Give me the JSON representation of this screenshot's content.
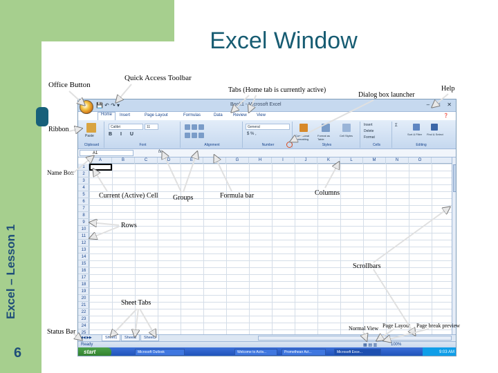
{
  "slide": {
    "title": "Excel Window",
    "side_label": "Excel – Lesson 1",
    "page_number": "6"
  },
  "annotations": {
    "office_button": "Office Button",
    "quick_access_toolbar": "Quick Access Toolbar",
    "tabs": "Tabs (Home tab is currently active)",
    "dialog_box_launcher": "Dialog box launcher",
    "help": "Help",
    "ribbon": "Ribbon",
    "name_box": "Name Box",
    "current_cell": "Current (Active) Cell",
    "groups": "Groups",
    "formula_bar": "Formula bar",
    "columns": "Columns",
    "rows": "Rows",
    "scrollbars": "Scrollbars",
    "sheet_tabs": "Sheet Tabs",
    "status_bar": "Status Bar",
    "normal_view": "Normal View",
    "page_layout": "Page Layout",
    "page_break_preview": "Page break preview"
  },
  "excel": {
    "window_title": "Book1 - Microsoft Excel",
    "tabs": [
      "Home",
      "Insert",
      "Page Layout",
      "Formulas",
      "Data",
      "Review",
      "View"
    ],
    "groups": [
      "Clipboard",
      "Font",
      "Alignment",
      "Number",
      "Styles",
      "Cells",
      "Editing"
    ],
    "font_name": "Calibri",
    "font_size": "11",
    "number_format": "General",
    "paste_label": "Paste",
    "styles_buttons": [
      "Conditional Formatting",
      "Format as Table",
      "Cell Styles"
    ],
    "cells_buttons": [
      "Insert",
      "Delete",
      "Format"
    ],
    "editing_buttons": [
      "Sort & Filter",
      "Find & Select"
    ],
    "name_box_value": "A1",
    "fx": "fx",
    "columns": [
      "A",
      "B",
      "C",
      "D",
      "E",
      "F",
      "G",
      "H",
      "I",
      "J",
      "K",
      "L",
      "M",
      "N",
      "O"
    ],
    "rows": [
      "1",
      "2",
      "3",
      "4",
      "5",
      "6",
      "7",
      "8",
      "9",
      "10",
      "11",
      "12",
      "13",
      "14",
      "15",
      "16",
      "17",
      "18",
      "19",
      "20",
      "21",
      "22",
      "23",
      "24",
      "25"
    ],
    "sheet_tabs": [
      "Sheet1",
      "Sheet2",
      "Sheet3"
    ],
    "status": "Ready",
    "zoom": "100%",
    "start_label": "start",
    "taskbar_items": [
      "Microsoft Outlook",
      "Welcome to Activ...",
      "Promethean Act...",
      "Microsoft Exce..."
    ],
    "clock": "9:03 AM"
  }
}
